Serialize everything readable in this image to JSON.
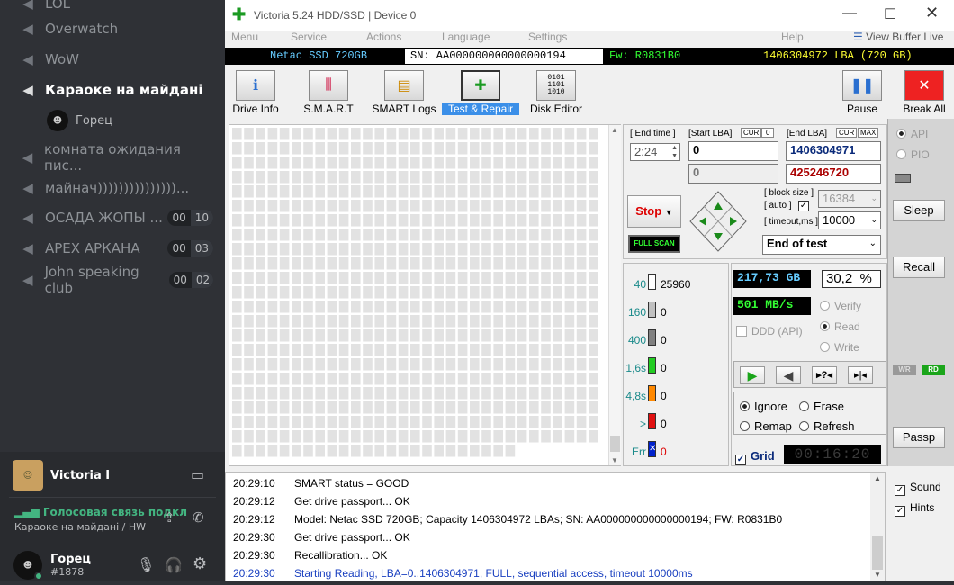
{
  "discord": {
    "channels": [
      {
        "name": "LOL"
      },
      {
        "name": "Overwatch"
      },
      {
        "name": "WoW"
      },
      {
        "name": "Караоке на майдані"
      }
    ],
    "member": "Горец",
    "lower_channels": [
      {
        "name": "комната ожидания пис..."
      },
      {
        "name": "майнач)))))))))))))))..."
      },
      {
        "name": "ОСАДА ЖОПЫ ...",
        "a": "00",
        "b": "10"
      },
      {
        "name": "APEX АРКАНА",
        "a": "00",
        "b": "03"
      },
      {
        "name": "John speaking club",
        "a": "00",
        "b": "02"
      }
    ],
    "activity_user": "Victoria I",
    "voice_status": "Голосовая связь подкл",
    "voice_channel": "Караоке на майдані / HW",
    "user_name": "Горец",
    "user_tag": "#1878"
  },
  "victoria": {
    "title": "Victoria 5.24 HDD/SSD | Device 0",
    "menu": [
      "Menu",
      "Service",
      "Actions",
      "Language",
      "Settings",
      "Help"
    ],
    "view_buffer": "View Buffer Live",
    "info": {
      "model": "Netac SSD 720GB",
      "sn": "SN: AA000000000000000194",
      "x": "x",
      "fw": "Fw: R0831B0",
      "lba": "1406304972 LBA (720 GB)"
    },
    "toolbar": [
      "Drive Info",
      "S.M.A.R.T",
      "SMART Logs",
      "Test & Repair",
      "Disk Editor"
    ],
    "pause": "Pause",
    "break_all": "Break All",
    "end_time_label": "[ End time ]",
    "end_time": "2:24",
    "start_lba_label": "[Start LBA]",
    "cur": "CUR",
    "zero_btn": "0",
    "start_lba": "0",
    "start_lba2": "0",
    "end_lba_label": "[End LBA]",
    "max": "MAX",
    "end_lba": "1406304971",
    "end_lba2": "425246720",
    "stop": "Stop",
    "full_scan": "FULL SCAN",
    "block_size_label": "[ block size ]",
    "auto_label": "[ auto ]",
    "block_size": "16384",
    "timeout_label": "[ timeout,ms ]",
    "timeout": "10000",
    "end_of_test": "End of test",
    "api": "API",
    "pio": "PIO",
    "sleep": "Sleep",
    "recall": "Recall",
    "passp": "Passp",
    "wr": "WR",
    "rd": "RD",
    "legend": [
      {
        "label": "40",
        "value": "25960",
        "color": "#ffffff"
      },
      {
        "label": "160",
        "value": "0",
        "color": "#c0c0c0"
      },
      {
        "label": "400",
        "value": "0",
        "color": "#808080"
      },
      {
        "label": "1,6s",
        "value": "0",
        "color": "#22cc22"
      },
      {
        "label": "4,8s",
        "value": "0",
        "color": "#ff8800"
      },
      {
        "label": ">",
        "value": "0",
        "color": "#e01010"
      },
      {
        "label": "Err",
        "value": "0",
        "color": "#0022cc"
      }
    ],
    "size_read": "217,73 GB",
    "percent": "30,2",
    "pct_sign": "%",
    "speed": "501 MB/s",
    "verify": "Verify",
    "read": "Read",
    "write": "Write",
    "ddd": "DDD (API)",
    "ignore": "Ignore",
    "erase": "Erase",
    "remap": "Remap",
    "refresh": "Refresh",
    "grid": "Grid",
    "timer": "00:16:20",
    "sound": "Sound",
    "hints": "Hints",
    "log": [
      {
        "time": "20:29:10",
        "msg": "SMART status = GOOD",
        "blue": false
      },
      {
        "time": "20:29:12",
        "msg": "Get drive passport... OK",
        "blue": false
      },
      {
        "time": "20:29:12",
        "msg": "Model: Netac SSD 720GB; Capacity 1406304972 LBAs; SN: AA000000000000000194; FW: R0831B0",
        "blue": false
      },
      {
        "time": "20:29:30",
        "msg": "Get drive passport... OK",
        "blue": false
      },
      {
        "time": "20:29:30",
        "msg": "Recallibration... OK",
        "blue": false
      },
      {
        "time": "20:29:30",
        "msg": "Starting Reading, LBA=0..1406304971, FULL, sequential access, timeout 10000ms",
        "blue": true
      }
    ],
    "scan_progress": 0.302
  }
}
